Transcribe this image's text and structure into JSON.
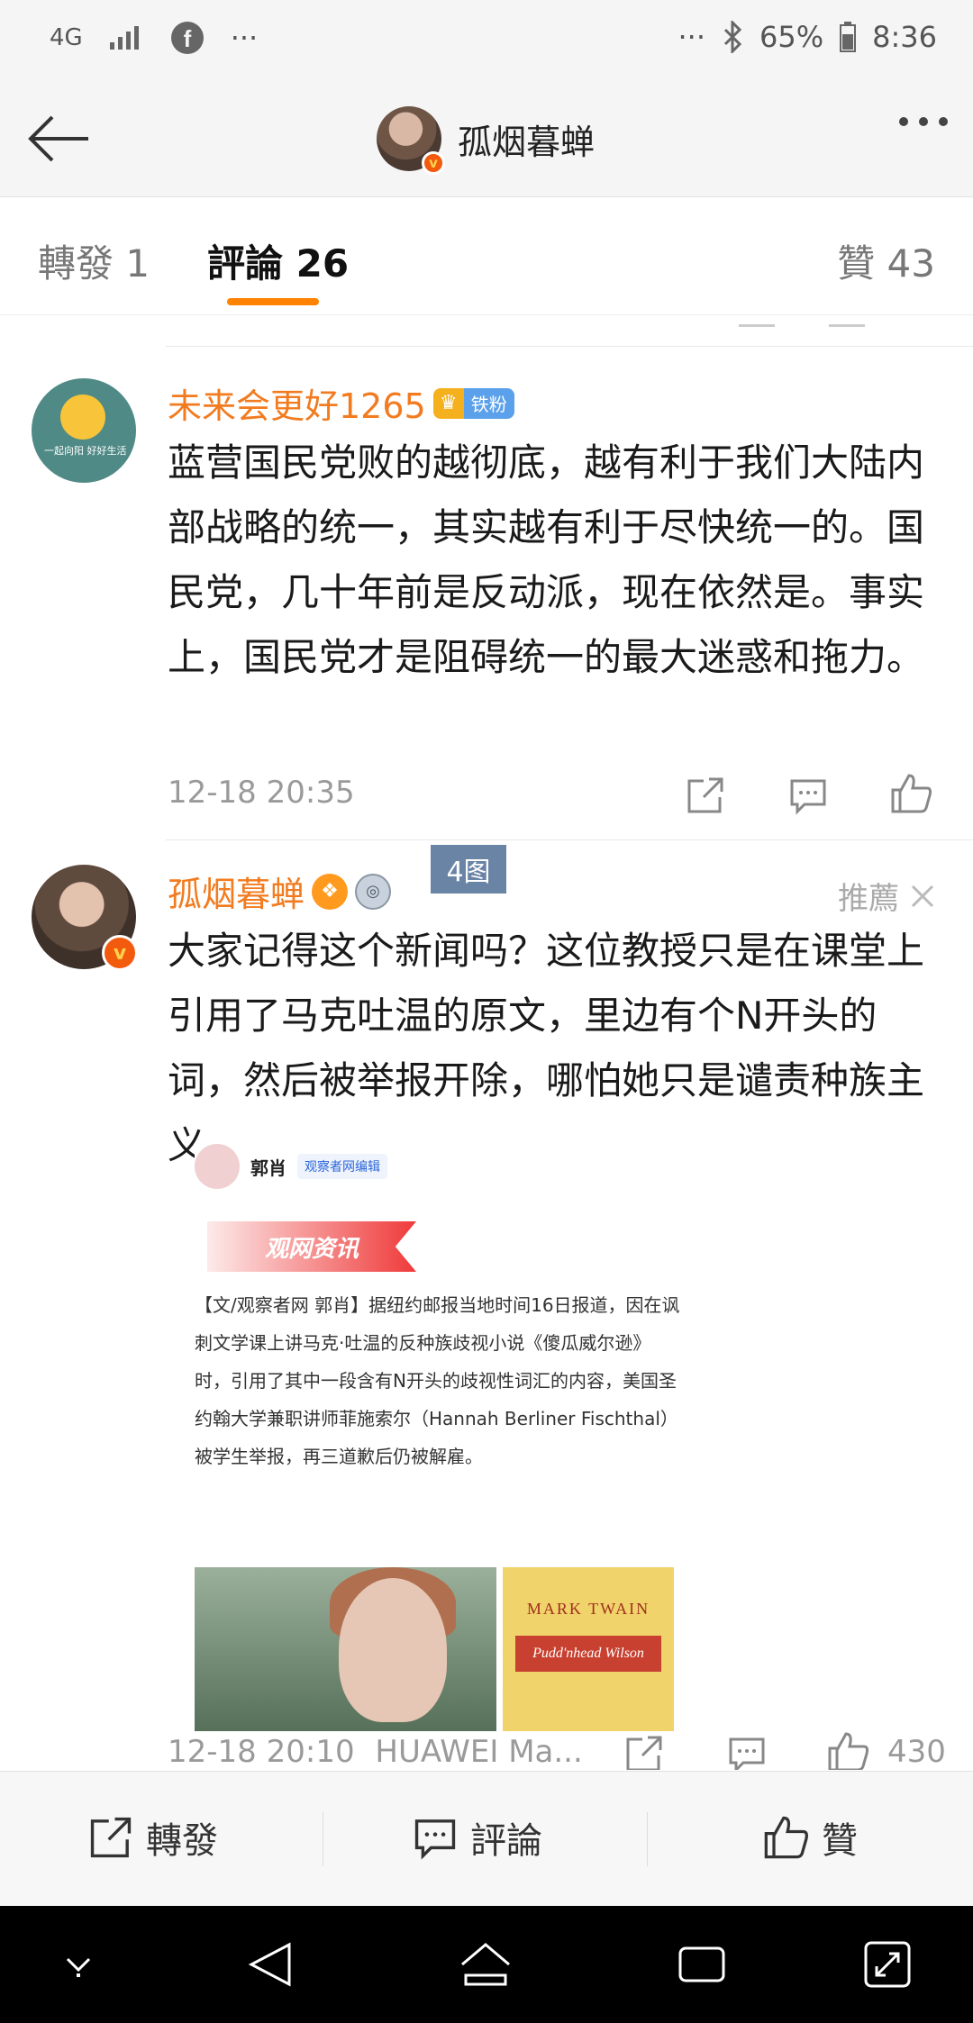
{
  "status_bar": {
    "network": "4G",
    "battery": "65%",
    "time": "8:36",
    "left_more": "···",
    "right_more": "···"
  },
  "nav": {
    "title": "孤烟暮蝉"
  },
  "tabs": {
    "repost": "轉發 1",
    "comments": "評論 26",
    "likes": "贊 43"
  },
  "comments": [
    {
      "username": "未来会更好1265",
      "badge_label": "铁粉",
      "avatar_text": "一起向阳 好好生活",
      "text": "蓝营国民党败的越彻底，越有利于我们大陆内部战略的统一，其实越有利于尽快统一的。国民党，几十年前是反动派，现在依然是。事实上，国民党才是阻碍统一的最大迷惑和拖力。",
      "time": "12-18 20:35"
    },
    {
      "username": "孤烟暮蝉",
      "recommend_label": "推薦",
      "text": "大家记得这个新闻吗？这位教授只是在课堂上引用了马克吐温的原文，里边有个N开头的词，然后被举报开除，哪怕她只是谴责种族主义。",
      "time": "12-18 20:10",
      "device": "HUAWEI Ma...",
      "like_count": "430",
      "image": {
        "author": "郭肖",
        "author_tag": "观察者网编辑",
        "banner": "观网资讯",
        "body": "【文/观察者网 郭肖】据纽约邮报当地时间16日报道，因在讽刺文学课上讲马克·吐温的反种族歧视小说《傻瓜威尔逊》时，引用了其中一段含有N开头的歧视性词汇的内容，美国圣约翰大学兼职讲师菲施索尔（Hannah Berliner Fischthal）被学生举报，再三道歉后仍被解雇。",
        "book_author": "MARK TWAIN",
        "book_title": "Pudd'nhead Wilson",
        "count": "4图"
      }
    }
  ],
  "bottom_bar": {
    "repost": "轉發",
    "comment": "評論",
    "like": "贊"
  },
  "colors": {
    "accent": "#ff8200",
    "username": "#f27b1f",
    "meta": "#9a9a9a"
  }
}
